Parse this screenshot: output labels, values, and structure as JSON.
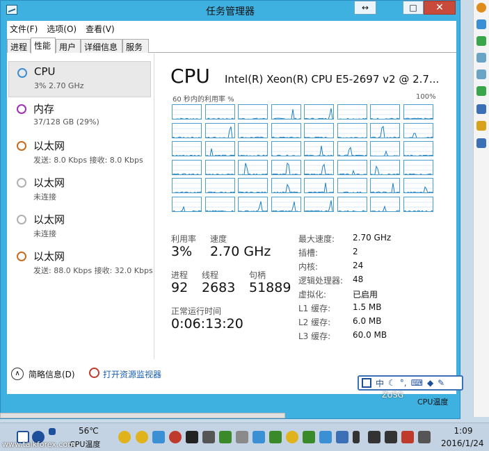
{
  "window": {
    "title": "任务管理器",
    "restore_glyph": "↔",
    "min_glyph": "─",
    "max_glyph": "□",
    "close_glyph": "✕"
  },
  "menu": [
    "文件(F)",
    "选项(O)",
    "查看(V)"
  ],
  "tabs": [
    "进程",
    "性能",
    "用户",
    "详细信息",
    "服务"
  ],
  "active_tab": "性能",
  "sidebar": [
    {
      "name": "CPU",
      "sub": "3% 2.70 GHz",
      "color": "#3b8fd4"
    },
    {
      "name": "内存",
      "sub": "37/128 GB (29%)",
      "color": "#a02fb5"
    },
    {
      "name": "以太网",
      "sub": "发送: 8.0 Kbps 接收: 8.0 Kbps",
      "color": "#c86b1e"
    },
    {
      "name": "以太网",
      "sub": "未连接",
      "color": "#b0b0b0"
    },
    {
      "name": "以太网",
      "sub": "未连接",
      "color": "#b0b0b0"
    },
    {
      "name": "以太网",
      "sub": "发送: 88.0 Kbps 接收: 32.0 Kbps",
      "color": "#c86b1e"
    }
  ],
  "cpu": {
    "title": "CPU",
    "model": "Intel(R) Xeon(R) CPU E5-2697 v2 @ 2.7...",
    "graph_label": "60 秒内的利用率 %",
    "graph_max": "100%",
    "util_label": "利用率",
    "util_value": "3%",
    "speed_label": "速度",
    "speed_value": "2.70 GHz",
    "proc_label": "进程",
    "proc_value": "92",
    "thread_label": "线程",
    "thread_value": "2683",
    "handle_label": "句柄",
    "handle_value": "51889",
    "uptime_label": "正常运行时间",
    "uptime_value": "0:06:13:20",
    "specs": [
      {
        "label": "最大速度:",
        "value": "2.70 GHz"
      },
      {
        "label": "插槽:",
        "value": "2"
      },
      {
        "label": "内核:",
        "value": "24"
      },
      {
        "label": "逻辑处理器:",
        "value": "48"
      },
      {
        "label": "虚拟化:",
        "value": "已启用"
      },
      {
        "label": "L1 缓存:",
        "value": "1.5 MB"
      },
      {
        "label": "L2 缓存:",
        "value": "6.0 MB"
      },
      {
        "label": "L3 缓存:",
        "value": "60.0 MB"
      }
    ]
  },
  "footer": {
    "brief": "简略信息(D)",
    "resmon": "打开资源监视器"
  },
  "ime": {
    "mode": "中",
    "shadow_text": "ZUSG",
    "temp_label": "CPU温度"
  },
  "taskbar": {
    "temp": "56℃",
    "temp_label": "CPU温度",
    "watermark": "www.talkforex.com",
    "time": "1:09",
    "date": "2016/1/24"
  }
}
